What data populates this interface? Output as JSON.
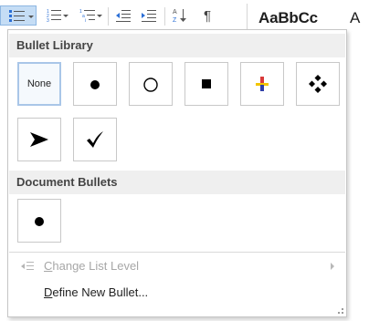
{
  "ribbon": {
    "styles_preview": "AaBbCc",
    "styles_preview_next": "A",
    "pilcrow": "¶"
  },
  "bullet_library": {
    "header": "Bullet Library",
    "none_label": "None",
    "tiles": [
      {
        "icon": "none"
      },
      {
        "icon": "filled-circle-bullet"
      },
      {
        "icon": "hollow-circle-bullet"
      },
      {
        "icon": "filled-square-bullet"
      },
      {
        "icon": "colored-cross-bullet"
      },
      {
        "icon": "four-diamond-bullet"
      },
      {
        "icon": "arrowhead-bullet"
      },
      {
        "icon": "checkmark-bullet"
      }
    ]
  },
  "document_bullets": {
    "header": "Document Bullets",
    "tiles": [
      {
        "icon": "filled-circle-bullet"
      }
    ]
  },
  "menu": {
    "change_list_level": {
      "hotkey": "C",
      "rest": "hange List Level"
    },
    "define_new_bullet": {
      "hotkey": "D",
      "rest": "efine New Bullet..."
    }
  },
  "colors": {
    "accent_selected": "#c5ddf5",
    "header_bg": "#efefef",
    "disabled_text": "#a7a7a7",
    "plus_red": "#d93a3a",
    "plus_yellow": "#f2c500",
    "plus_blue": "#2f3fa8"
  }
}
